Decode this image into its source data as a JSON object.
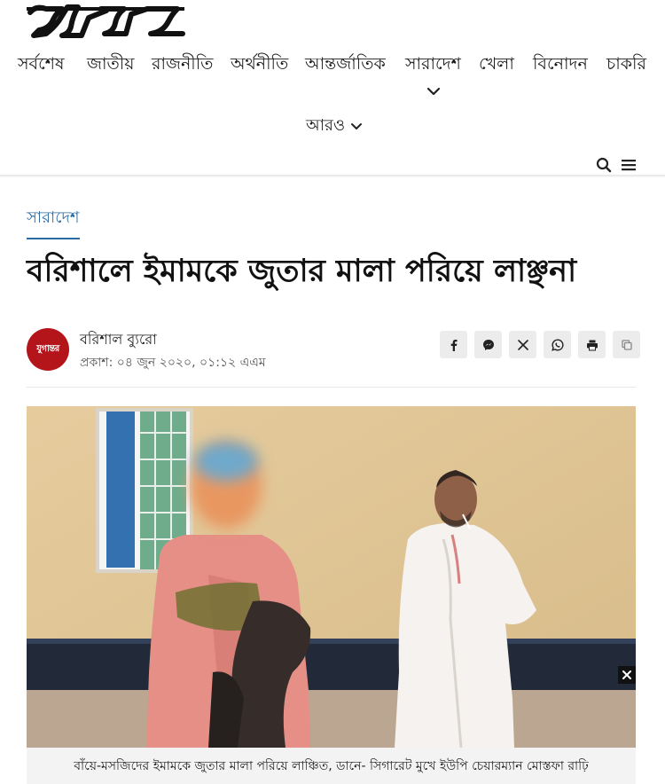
{
  "header": {
    "logo_text": "যুগান্তর",
    "nav": [
      {
        "label": "সর্বশেষ"
      },
      {
        "label": "জাতীয়"
      },
      {
        "label": "রাজনীতি"
      },
      {
        "label": "অর্থনীতি"
      },
      {
        "label": "আন্তর্জাতিক"
      },
      {
        "label": "সারাদেশ"
      },
      {
        "label": "খেলা"
      },
      {
        "label": "বিনোদন"
      },
      {
        "label": "চাকরি"
      }
    ],
    "more_label": "আরও",
    "icons": [
      "search-icon",
      "menu-icon",
      "chevron-down-icon"
    ]
  },
  "article": {
    "category": "সারাদেশ",
    "headline": "বরিশালে ইমামকে জুতার মালা পরিয়ে লাঞ্ছনা",
    "author": {
      "avatar_text": "যুগান্তর",
      "name": "বরিশাল ব্যুরো",
      "published": "প্রকাশ: ০৪ জুন ২০২০, ০১:১২ এএম"
    },
    "share_icons": [
      "facebook-icon",
      "messenger-icon",
      "x-icon",
      "whatsapp-icon",
      "print-icon",
      "copy-icon"
    ],
    "image": {
      "caption": "বাঁয়ে-মসজিদের ইমামকে জুতার মালা পরিয়ে লাঞ্চিত, ডানে- সিগারেট মুখে ইউপি চেয়ারম্যান মোস্তফা রাঢ়ি"
    }
  },
  "colors": {
    "accent": "#2a6aa5",
    "brand_red": "#b3151b",
    "share_bg": "#ececec",
    "caption_bg": "#f3f3f3"
  }
}
